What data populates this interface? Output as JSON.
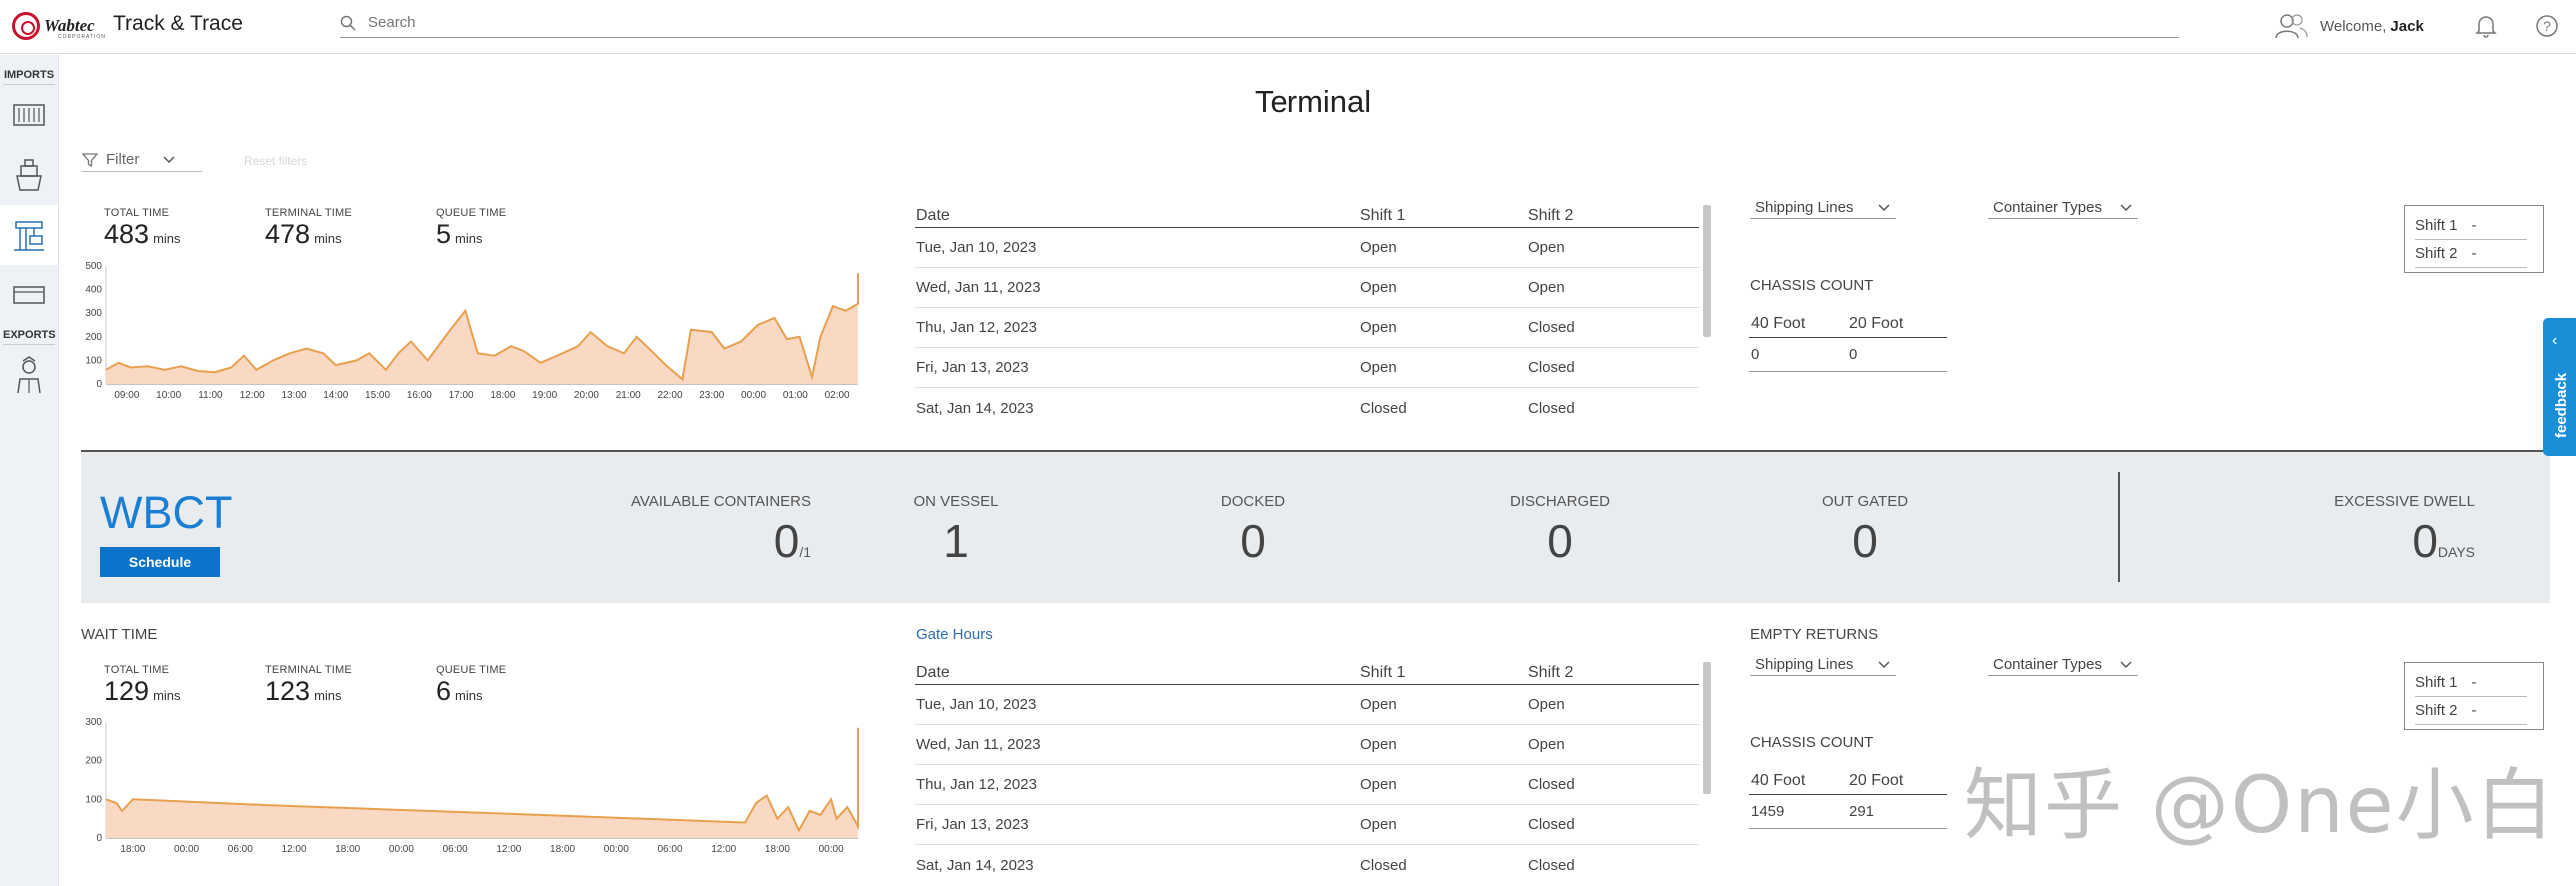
{
  "header": {
    "logo_text": "Wabtec",
    "logo_sub": "CORPORATION",
    "app_title": "Track & Trace",
    "search_placeholder": "Search",
    "welcome_prefix": "Welcome,",
    "user_name": "Jack"
  },
  "sidebar": {
    "imports_label": "IMPORTS",
    "exports_label": "EXPORTS",
    "items": [
      {
        "icon": "container-icon"
      },
      {
        "icon": "vessel-icon"
      },
      {
        "icon": "terminal-crane-icon",
        "active": true
      },
      {
        "icon": "chassis-icon"
      },
      {
        "icon": "driver-icon"
      }
    ]
  },
  "page": {
    "title": "Terminal",
    "filter_label": "Filter",
    "reset_label": "Reset filters"
  },
  "top_section": {
    "metrics": [
      {
        "label": "TOTAL TIME",
        "value": "483",
        "unit": "mins"
      },
      {
        "label": "TERMINAL TIME",
        "value": "478",
        "unit": "mins"
      },
      {
        "label": "QUEUE TIME",
        "value": "5",
        "unit": "mins"
      }
    ],
    "schedule": {
      "headers": [
        "Date",
        "Shift 1",
        "Shift 2"
      ],
      "rows": [
        [
          "Tue, Jan 10, 2023",
          "Open",
          "Open"
        ],
        [
          "Wed, Jan 11, 2023",
          "Open",
          "Open"
        ],
        [
          "Thu, Jan 12, 2023",
          "Open",
          "Closed"
        ],
        [
          "Fri, Jan 13, 2023",
          "Open",
          "Closed"
        ],
        [
          "Sat, Jan 14, 2023",
          "Closed",
          "Closed"
        ]
      ]
    },
    "shipping_lines": "Shipping Lines",
    "container_types": "Container Types",
    "shift1": "Shift 1",
    "shift2": "Shift 2",
    "shift_value": "-",
    "chassis_title": "CHASSIS COUNT",
    "chassis_headers": [
      "40 Foot",
      "20 Foot"
    ],
    "chassis_values": [
      "0",
      "0"
    ]
  },
  "band": {
    "terminal_name": "WBCT",
    "schedule_button": "Schedule",
    "stats": [
      {
        "label": "AVAILABLE CONTAINERS",
        "value": "0",
        "suffix": "/1"
      },
      {
        "label": "ON VESSEL",
        "value": "1",
        "suffix": ""
      },
      {
        "label": "DOCKED",
        "value": "0",
        "suffix": ""
      },
      {
        "label": "DISCHARGED",
        "value": "0",
        "suffix": ""
      },
      {
        "label": "OUT GATED",
        "value": "0",
        "suffix": ""
      },
      {
        "label": "EXCESSIVE DWELL",
        "value": "0",
        "suffix": "DAYS"
      }
    ]
  },
  "bottom_section": {
    "wait_time_label": "WAIT TIME",
    "gate_hours_label": "Gate Hours",
    "empty_returns_label": "EMPTY RETURNS",
    "metrics": [
      {
        "label": "TOTAL TIME",
        "value": "129",
        "unit": "mins"
      },
      {
        "label": "TERMINAL TIME",
        "value": "123",
        "unit": "mins"
      },
      {
        "label": "QUEUE TIME",
        "value": "6",
        "unit": "mins"
      }
    ],
    "schedule": {
      "headers": [
        "Date",
        "Shift 1",
        "Shift 2"
      ],
      "rows": [
        [
          "Tue, Jan 10, 2023",
          "Open",
          "Open"
        ],
        [
          "Wed, Jan 11, 2023",
          "Open",
          "Open"
        ],
        [
          "Thu, Jan 12, 2023",
          "Open",
          "Closed"
        ],
        [
          "Fri, Jan 13, 2023",
          "Open",
          "Closed"
        ],
        [
          "Sat, Jan 14, 2023",
          "Closed",
          "Closed"
        ]
      ]
    },
    "shipping_lines": "Shipping Lines",
    "container_types": "Container Types",
    "shift1": "Shift 1",
    "shift2": "Shift 2",
    "shift_value": "-",
    "chassis_title": "CHASSIS COUNT",
    "chassis_headers": [
      "40 Foot",
      "20 Foot"
    ],
    "chassis_values": [
      "1459",
      "291"
    ]
  },
  "feedback_label": "feedback",
  "watermark": "知乎 @One小白",
  "colors": {
    "accent": "#1a7fd4",
    "chart_line": "#e8a04f",
    "chart_fill": "#f9d9c4",
    "button": "#0b73c9",
    "feedback": "#1a8fd8"
  },
  "chart_data": [
    {
      "type": "area",
      "ylim": [
        0,
        500
      ],
      "yticks": [
        0,
        100,
        200,
        300,
        400,
        500
      ],
      "xticks": [
        "09:00",
        "10:00",
        "11:00",
        "12:00",
        "13:00",
        "14:00",
        "15:00",
        "16:00",
        "17:00",
        "18:00",
        "19:00",
        "20:00",
        "21:00",
        "22:00",
        "23:00",
        "00:00",
        "01:00",
        "02:00"
      ],
      "x_range": [
        0,
        18
      ],
      "series": [
        {
          "points": [
            [
              0,
              60
            ],
            [
              0.3,
              90
            ],
            [
              0.6,
              70
            ],
            [
              1,
              75
            ],
            [
              1.4,
              60
            ],
            [
              1.8,
              75
            ],
            [
              2.2,
              55
            ],
            [
              2.6,
              50
            ],
            [
              3,
              70
            ],
            [
              3.3,
              120
            ],
            [
              3.6,
              60
            ],
            [
              4,
              100
            ],
            [
              4.4,
              130
            ],
            [
              4.8,
              150
            ],
            [
              5.2,
              130
            ],
            [
              5.5,
              80
            ],
            [
              6,
              100
            ],
            [
              6.3,
              130
            ],
            [
              6.7,
              60
            ],
            [
              7,
              130
            ],
            [
              7.3,
              180
            ],
            [
              7.7,
              100
            ],
            [
              8.2,
              220
            ],
            [
              8.6,
              310
            ],
            [
              8.9,
              130
            ],
            [
              9.3,
              120
            ],
            [
              9.7,
              160
            ],
            [
              10,
              140
            ],
            [
              10.4,
              90
            ],
            [
              10.8,
              120
            ],
            [
              11.3,
              160
            ],
            [
              11.6,
              220
            ],
            [
              12,
              160
            ],
            [
              12.4,
              130
            ],
            [
              12.7,
              200
            ],
            [
              13,
              150
            ],
            [
              13.4,
              80
            ],
            [
              13.8,
              20
            ],
            [
              14,
              230
            ],
            [
              14.5,
              220
            ],
            [
              14.8,
              150
            ],
            [
              15.2,
              180
            ],
            [
              15.6,
              250
            ],
            [
              16,
              280
            ],
            [
              16.3,
              190
            ],
            [
              16.6,
              200
            ],
            [
              16.9,
              30
            ],
            [
              17.1,
              200
            ],
            [
              17.4,
              330
            ],
            [
              17.7,
              310
            ],
            [
              18,
              340
            ],
            [
              18.2,
              470
            ]
          ]
        }
      ]
    },
    {
      "type": "area",
      "ylim": [
        0,
        300
      ],
      "yticks": [
        0,
        100,
        200,
        300
      ],
      "xticks": [
        "18:00",
        "00:00",
        "06:00",
        "12:00",
        "18:00",
        "00:00",
        "06:00",
        "12:00",
        "18:00",
        "00:00",
        "06:00",
        "12:00",
        "18:00",
        "00:00"
      ],
      "x_range": [
        0,
        14
      ],
      "series": [
        {
          "points": [
            [
              0,
              100
            ],
            [
              0.2,
              90
            ],
            [
              0.3,
              70
            ],
            [
              0.5,
              100
            ],
            [
              3,
              85
            ],
            [
              6,
              70
            ],
            [
              9,
              55
            ],
            [
              11.5,
              42
            ],
            [
              11.9,
              40
            ],
            [
              12.1,
              90
            ],
            [
              12.3,
              110
            ],
            [
              12.5,
              50
            ],
            [
              12.7,
              80
            ],
            [
              12.9,
              20
            ],
            [
              13.1,
              70
            ],
            [
              13.3,
              60
            ],
            [
              13.5,
              100
            ],
            [
              13.6,
              50
            ],
            [
              13.8,
              80
            ],
            [
              14.0,
              30
            ],
            [
              14.2,
              120
            ],
            [
              14.4,
              80
            ],
            [
              14.6,
              150
            ],
            [
              14.7,
              285
            ],
            [
              14.9,
              50
            ],
            [
              15.1,
              250
            ],
            [
              15.3,
              60
            ],
            [
              15.5,
              130
            ],
            [
              15.6,
              110
            ]
          ]
        }
      ]
    }
  ]
}
